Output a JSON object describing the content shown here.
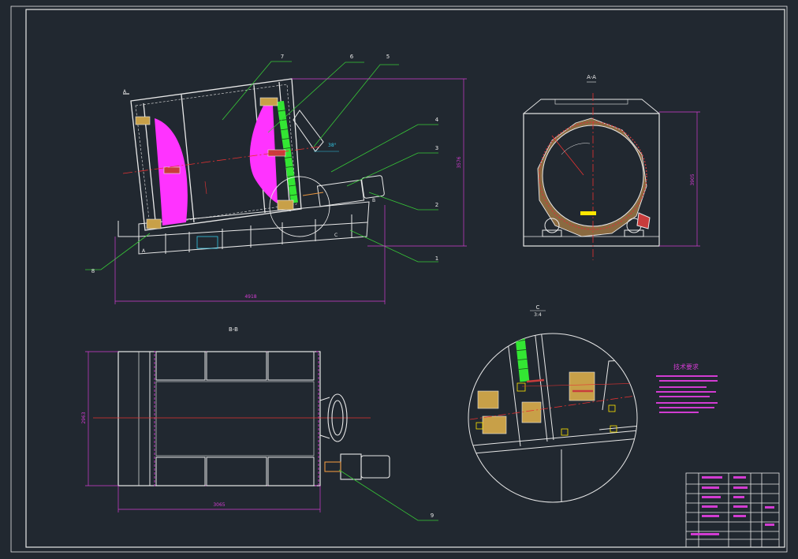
{
  "colors": {
    "background": "#212830",
    "outline": "#e8e8e8",
    "leader": "#37c837",
    "dimension": "#d23cd2",
    "centerline": "#e63232",
    "fill_magenta": "#ff33ff",
    "fill_green": "#33e633",
    "accent_yellow": "#ffe600",
    "accent_cyan": "#33c8e6",
    "accent_orange": "#e89640"
  },
  "labels": {
    "part_1": "1",
    "part_2": "2",
    "part_3": "3",
    "part_4": "4",
    "part_5": "5",
    "part_6": "6",
    "part_7": "7",
    "part_8": "8",
    "part_9": "9"
  },
  "views": {
    "section_aa": "A-A",
    "section_bb": "B-B",
    "detail_c": "C",
    "detail_c_scale": "3:4",
    "section_mark_a": "A",
    "detail_mark_c": "C",
    "section_mark_b": "B"
  },
  "dims": {
    "main_width": "4918",
    "main_height": "3576",
    "aa_height": "3905",
    "bb_width": "3065",
    "bb_height": "2963"
  },
  "notes": {
    "title": "技术要求"
  }
}
